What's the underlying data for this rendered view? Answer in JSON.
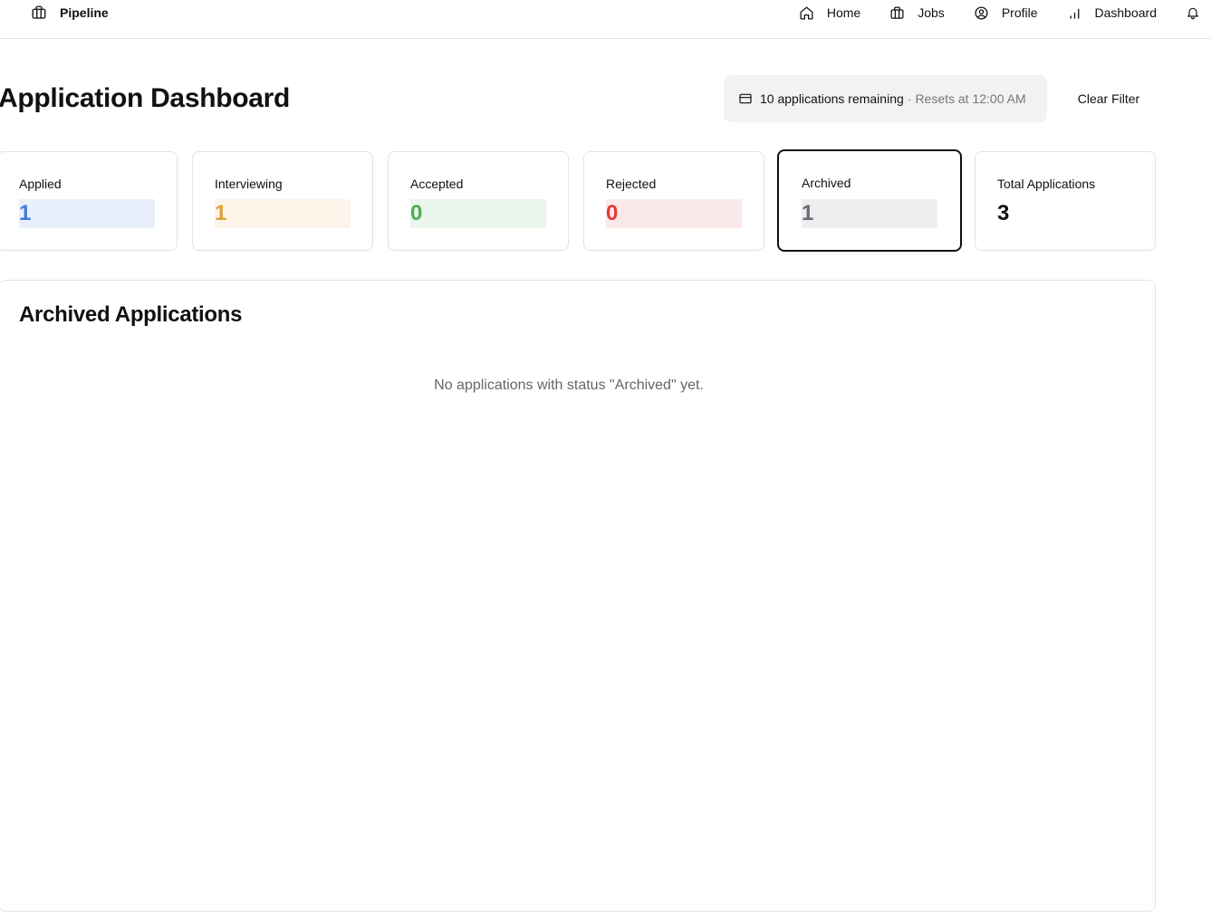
{
  "nav": {
    "brand": "Pipeline",
    "items": [
      {
        "label": "Home",
        "icon": "home-icon"
      },
      {
        "label": "Jobs",
        "icon": "briefcase-icon"
      },
      {
        "label": "Profile",
        "icon": "user-circle-icon"
      },
      {
        "label": "Dashboard",
        "icon": "bar-chart-icon"
      }
    ],
    "bell_icon": "bell-icon"
  },
  "header": {
    "title": "Application Dashboard",
    "quota": {
      "main": "10 applications remaining",
      "separator": "·",
      "reset": "Resets at 12:00 AM",
      "icon": "credit-card-icon"
    },
    "clear_filter": "Clear Filter"
  },
  "stats": [
    {
      "label": "Applied",
      "value": "1",
      "color": "#3b7ddd",
      "bg": "#e9f0fc"
    },
    {
      "label": "Interviewing",
      "value": "1",
      "color": "#e0a33a",
      "bg": "#fdf4ea"
    },
    {
      "label": "Accepted",
      "value": "0",
      "color": "#4caf50",
      "bg": "#eaf5ec"
    },
    {
      "label": "Rejected",
      "value": "0",
      "color": "#e53935",
      "bg": "#fbe9e9"
    },
    {
      "label": "Archived",
      "value": "1",
      "color": "#6b6b75",
      "bg": "#eeeef0",
      "selected": true
    },
    {
      "label": "Total Applications",
      "value": "3"
    }
  ],
  "panel": {
    "title": "Archived Applications",
    "empty": "No applications with status \"Archived\" yet."
  }
}
